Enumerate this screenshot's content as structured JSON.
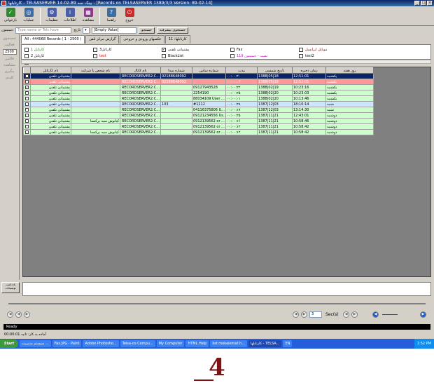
{
  "window": {
    "title": "کارتابلها - TELSASERVER  14-02-89  بینک سه - [Records on TELSASERVER  1389/3/3 Version: 89-02-14]",
    "controls": [
      "_",
      "□",
      "×"
    ]
  },
  "toolbar": {
    "buttons": [
      {
        "label": "بازخوانی",
        "icon": "refresh-icon",
        "color": "#2e8b2e",
        "glyph": "✓"
      },
      {
        "label": "عملیات",
        "icon": "operations-icon",
        "color": "#3a6ea5",
        "glyph": "◎"
      },
      {
        "label": "تنظیمات",
        "icon": "settings-icon",
        "color": "#4a5fa8",
        "glyph": "⚙"
      },
      {
        "label": "اطلاعات",
        "icon": "info-icon",
        "color": "#4a5fa8",
        "glyph": "i"
      },
      {
        "label": "مشاهده",
        "icon": "view-icon",
        "color": "#8a3a8a",
        "glyph": "▦"
      },
      {
        "label": "راهنما",
        "icon": "help-icon",
        "color": "#3a6ea5",
        "glyph": "?"
      },
      {
        "label": "خروج",
        "icon": "exit-icon",
        "color": "#cc2a2a",
        "glyph": "⏻"
      }
    ]
  },
  "filter": {
    "label": "دستیتون",
    "search_placeholder": "Type name or Tels have",
    "date_label": "تاریخ",
    "empty_value": "[Empty Value]",
    "search_button": "جستجو",
    "advanced_button": "جستجوی پیشرفته"
  },
  "sidepanel": {
    "items": [
      "جستجوی",
      "فعالیت",
      "2500",
      "فاکس",
      "مشاهده",
      "پیگیری",
      "کلیدی"
    ]
  },
  "tabs": [
    {
      "label": "All : 444068 Records ( 1 - 2500 )",
      "active": true
    },
    {
      "label": "گزارش مرکز تلفن"
    },
    {
      "label": "فکسهای ورودی و خروجی"
    },
    {
      "label": "کارتابلها: 11"
    }
  ],
  "checkboxes": [
    {
      "label": "کارتابل 1",
      "checked": false,
      "color": "#008000"
    },
    {
      "label": "کارتابل3",
      "checked": false,
      "color": "#000000"
    },
    {
      "label": "پشتیبانی تلفنی",
      "checked": true,
      "color": "#000000"
    },
    {
      "label": "Fax",
      "checked": false,
      "color": "#000000"
    },
    {
      "label": "موبایل ایرانسل",
      "checked": false,
      "color": "#800000"
    },
    {
      "label": "کارتابل 2",
      "checked": false,
      "color": "#000000"
    },
    {
      "label": "test",
      "checked": false,
      "color": "#cc0000"
    },
    {
      "label": "BlackList",
      "checked": false,
      "color": "#000000"
    },
    {
      "label": "تست - دستیتون 119",
      "checked": false,
      "color": "#cc00cc"
    },
    {
      "label": "test2",
      "checked": false,
      "color": "#000000"
    },
    {
      "label": "pppppppppppp",
      "checked": false,
      "color": "#000080"
    }
  ],
  "grid": {
    "columns": [
      "",
      "نام کارتابل",
      "نام شخص یا شرکت",
      "نام کانال",
      "شماره مبدا",
      "شماره تماس",
      "مدت",
      "تاریخ شمسی",
      "زمان ذخیره",
      "روز هفته"
    ],
    "rows": [
      {
        "type": "sel",
        "cells": [
          "",
          "پشتیبانی تلفنی",
          "",
          "RECORDSERVER2:C...",
          "02188648092",
          "",
          "۰۰:۰۰:۲۰",
          "1388|05|18",
          "12:51:01",
          "یکشنبه"
        ]
      },
      {
        "type": "red",
        "cells": [
          "",
          "پشتیبانی تلفنی",
          "",
          "RECORDSERVER2:C...",
          "02188648092",
          "",
          "۰۰:۰۰:۰۳",
          "1388|05|18",
          "12:51:01",
          "یکشنبه"
        ]
      },
      {
        "type": "green",
        "cells": [
          "✓",
          "پشتیبانی تلفنی",
          "",
          "RECORDSERVER2:C...",
          "",
          "09127943528",
          "۰۰:۰۰:۲۲",
          "1388|02|19",
          "10:23:16",
          "یکشنبه"
        ]
      },
      {
        "type": "green",
        "cells": [
          "",
          "پشتیبانی تلفنی",
          "",
          "RECORDSERVER2:C...",
          "",
          "2254190",
          "۰۰:۰۰:۲۵",
          "1388|02|20",
          "10:23:03",
          "یکشنبه"
        ]
      },
      {
        "type": "green",
        "cells": [
          "",
          "پشتیبانی تلفنی",
          "",
          "RECORDSERVER2:C...",
          "",
          "88034109 User ...",
          "۰۰:۰۰:۰۱",
          "1388|02|20",
          "10:13:46",
          "یکشنبه"
        ]
      },
      {
        "type": "blue",
        "cells": [
          "",
          "پشتیبانی تلفنی",
          "",
          "RECORDSERVER2:C...",
          "103",
          "#1212",
          "۰۰:۰۰:۲۸",
          "1387|12|03",
          "18:10:14",
          "شنبه"
        ]
      },
      {
        "type": "green",
        "cells": [
          "",
          "پشتیبانی تلفنی",
          "",
          "RECORDSERVER2:C...",
          "",
          "04116375806 U...",
          "۰۰:۰۰:۱۷",
          "1387|12|03",
          "13:14:30",
          "شنبه"
        ]
      },
      {
        "type": "green",
        "cells": [
          "",
          "پشتیبانی تلفنی",
          "",
          "RECORDSERVER2:C...",
          "",
          "09121234556 Us...",
          "۰۰:۰۰:۲۵",
          "1387|11|21",
          "12:43:01",
          "دوشنبه"
        ]
      },
      {
        "type": "green",
        "cells": [
          "",
          "پشتیبانی تلفنی",
          "کیانوش سیه پرکنسا",
          "RECORDSERVER2:C...",
          "",
          "0912139562 or ...",
          "۰۰:۰۰:۱۶",
          "1387|11|21",
          "10:58:46",
          "دوشنبه"
        ]
      },
      {
        "type": "green",
        "cells": [
          "",
          "پشتیبانی تلفنی",
          "",
          "RECORDSERVER2:C...",
          "",
          "0912139562 or ...",
          "۰۰:۰۰:۱۲",
          "1387|11|21",
          "10:58:42",
          "دوشنبه"
        ]
      },
      {
        "type": "green",
        "cells": [
          "",
          "پشتیبانی تلفنی",
          "کیانوش سیه پرکنسا",
          "RECORDSERVER2:C...",
          "",
          "0912139562 or ...",
          "۰۰:۰۰:۱۲",
          "1387|11|21",
          "10:58:42",
          "دوشنبه"
        ]
      }
    ]
  },
  "detail": {
    "button_label": "یادداشت توضیحات"
  },
  "player": {
    "seconds_value": "3",
    "seconds_label": "Sec(s)"
  },
  "status": {
    "text": "Ready"
  },
  "quickbar": {
    "text": "آماده به کار: ثانیه   00:00:01"
  },
  "taskbar": {
    "start": "Start",
    "tasks": [
      "سیستم مدیریت ...",
      "Fax.JPG - Paint",
      "Adobe Photosho...",
      "Telsa-co Compu...",
      "My Computer",
      "HTML Help",
      "list mokalemat.h...",
      "کارتابلها - TELSA...",
      "EN"
    ],
    "active_index": 7,
    "time": "1:52 PM"
  },
  "footer_number": "4"
}
